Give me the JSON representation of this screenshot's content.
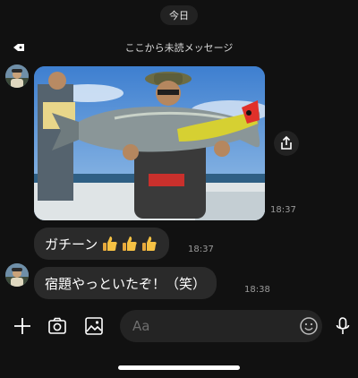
{
  "header": {
    "date_label": "今日",
    "unread_divider": "ここから未読メッセージ"
  },
  "messages": [
    {
      "type": "image",
      "sender_avatar": "avatar-friend",
      "time": "18:37",
      "image_description_icon": "photo-icon"
    },
    {
      "type": "text",
      "text": "ガチーン",
      "emoji": [
        "👍",
        "👍",
        "👍"
      ],
      "time": "18:37"
    },
    {
      "type": "text",
      "sender_avatar": "avatar-friend",
      "text": "宿題やっといたぞ！（笑）",
      "time": "18:38"
    }
  ],
  "input_bar": {
    "placeholder": "Aa",
    "icons": [
      "plus-icon",
      "camera-icon",
      "gallery-icon",
      "emoji-icon",
      "microphone-icon"
    ]
  },
  "colors": {
    "background": "#111111",
    "bubble": "#2a2a2a",
    "time_text": "#9a9a9a",
    "input_field": "#242424"
  }
}
